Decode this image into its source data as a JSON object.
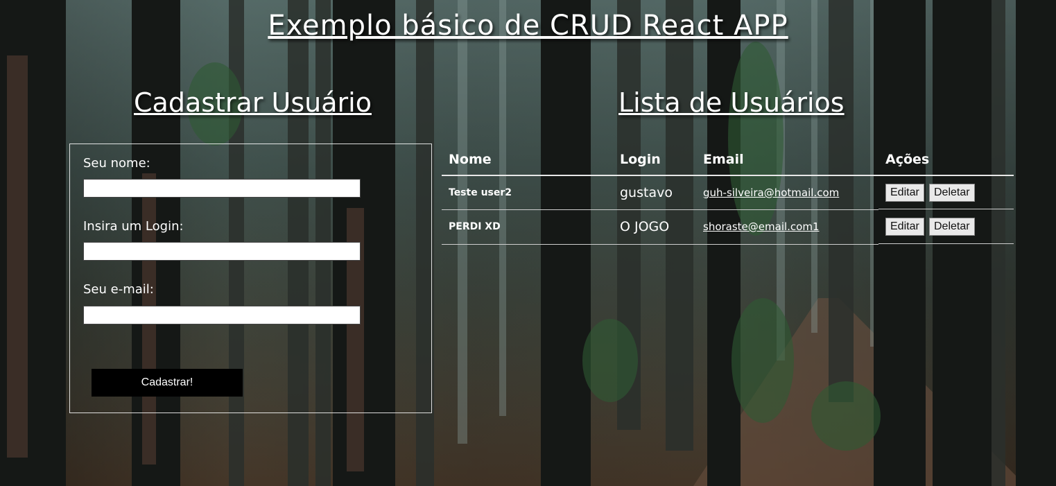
{
  "page": {
    "title": "Exemplo básico de CRUD React APP"
  },
  "form": {
    "heading": "Cadastrar Usuário",
    "name_label": "Seu nome:",
    "name_value": "",
    "login_label": "Insira um Login:",
    "login_value": "",
    "email_label": "Seu e-mail:",
    "email_value": "",
    "submit_label": "Cadastrar!"
  },
  "list": {
    "heading": "Lista de Usuários",
    "columns": [
      "Nome",
      "Login",
      "Email",
      "Ações"
    ],
    "rows": [
      {
        "name": "Teste user2",
        "login": "gustavo",
        "email": "guh-silveira@hotmail.com",
        "edit_label": "Editar",
        "delete_label": "Deletar"
      },
      {
        "name": "PERDI XD",
        "login": "O JOGO",
        "email": "shoraste@email.com1",
        "edit_label": "Editar",
        "delete_label": "Deletar"
      }
    ]
  },
  "colors": {
    "text": "#ffffff",
    "button_bg": "#000000",
    "action_button_bg": "#e9e9e9"
  }
}
